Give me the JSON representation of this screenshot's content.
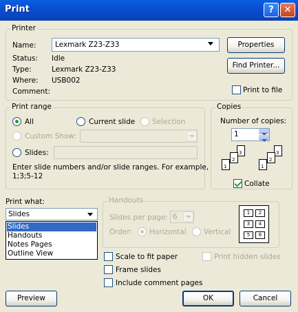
{
  "window": {
    "title": "Print",
    "help_glyph": "?",
    "close_glyph": "✕"
  },
  "printer": {
    "legend": "Printer",
    "name_label": "Name:",
    "name_value": "Lexmark Z23-Z33",
    "status_label": "Status:",
    "status_value": "Idle",
    "type_label": "Type:",
    "type_value": "Lexmark Z23-Z33",
    "where_label": "Where:",
    "where_value": "USB002",
    "comment_label": "Comment:",
    "properties_button": "Properties",
    "find_printer_button": "Find Printer...",
    "print_to_file_label": "Print to file",
    "print_to_file_checked": false
  },
  "print_range": {
    "legend": "Print range",
    "all_label": "All",
    "all_selected": true,
    "current_slide_label": "Current slide",
    "selection_label": "Selection",
    "custom_show_label": "Custom Show:",
    "slides_label": "Slides:",
    "slides_value": "",
    "hint_line1": "Enter slide numbers and/or slide ranges. For example,",
    "hint_line2": "1;3;5-12"
  },
  "copies": {
    "legend": "Copies",
    "number_label": "Number of copies:",
    "number_value": "1",
    "collate_label": "Collate",
    "collate_checked": true,
    "collate_sheets": [
      "1",
      "2",
      "3"
    ]
  },
  "print_what": {
    "label": "Print what:",
    "selected": "Slides",
    "options": [
      "Slides",
      "Handouts",
      "Notes Pages",
      "Outline View"
    ],
    "highlighted_index": 0
  },
  "handouts": {
    "legend": "Handouts",
    "slides_per_page_label": "Slides per page:",
    "slides_per_page_value": "6",
    "order_label": "Order:",
    "horizontal_label": "Horizontal",
    "vertical_label": "Vertical",
    "preview_cells": [
      "1",
      "2",
      "3",
      "4",
      "5",
      "6"
    ]
  },
  "options": {
    "scale_to_fit_label": "Scale to fit paper",
    "frame_slides_label": "Frame slides",
    "include_comments_label": "Include comment pages",
    "print_hidden_label": "Print hidden slides"
  },
  "buttons": {
    "preview": "Preview",
    "ok": "OK",
    "cancel": "Cancel"
  },
  "colors": {
    "titlebar": "#0a4ed0",
    "dialog_bg": "#ece9d8",
    "highlight": "#316ac5"
  }
}
